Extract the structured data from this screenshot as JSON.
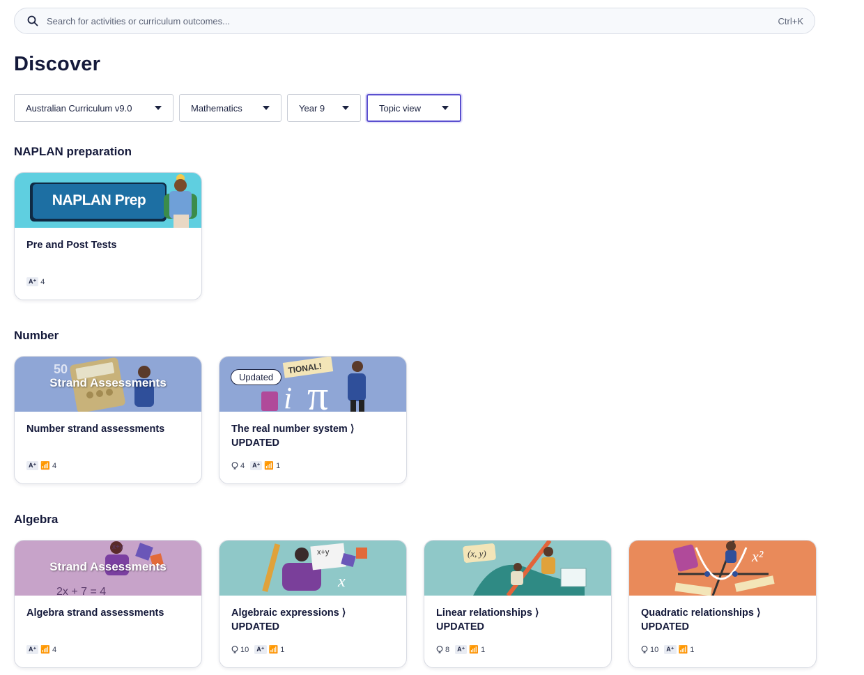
{
  "search": {
    "placeholder": "Search for activities or curriculum outcomes...",
    "shortcut": "Ctrl+K"
  },
  "page": {
    "title": "Discover"
  },
  "filters": [
    {
      "label": "Australian Curriculum v9.0"
    },
    {
      "label": "Mathematics"
    },
    {
      "label": "Year 9"
    },
    {
      "label": "Topic view"
    }
  ],
  "sections": [
    {
      "title": "NAPLAN preparation",
      "cards": [
        {
          "thumb_text": "NAPLAN Prep",
          "title": "Pre and Post Tests",
          "assessments": "4"
        }
      ]
    },
    {
      "title": "Number",
      "cards": [
        {
          "thumb_text": "Strand Assessments",
          "title": "Number strand assessments",
          "assessments": "4"
        },
        {
          "badge": "Updated",
          "title": "The real number system ⟩ UPDATED",
          "ideas": "4",
          "assessments": "1"
        }
      ]
    },
    {
      "title": "Algebra",
      "cards": [
        {
          "thumb_text": "Strand Assessments",
          "title": "Algebra strand assessments",
          "assessments": "4"
        },
        {
          "title": "Algebraic expressions ⟩ UPDATED",
          "ideas": "10",
          "assessments": "1"
        },
        {
          "title": "Linear relationships ⟩ UPDATED",
          "ideas": "8",
          "assessments": "1"
        },
        {
          "title": "Quadratic relationships ⟩ UPDATED",
          "ideas": "10",
          "assessments": "1"
        }
      ]
    }
  ],
  "colors": {
    "accent": "#5a4fcf",
    "text": "#14193a"
  },
  "icons": {
    "search": "search-icon",
    "caret": "caret-down-icon",
    "idea": "lightbulb-icon",
    "assessment": "assessment-icon"
  }
}
